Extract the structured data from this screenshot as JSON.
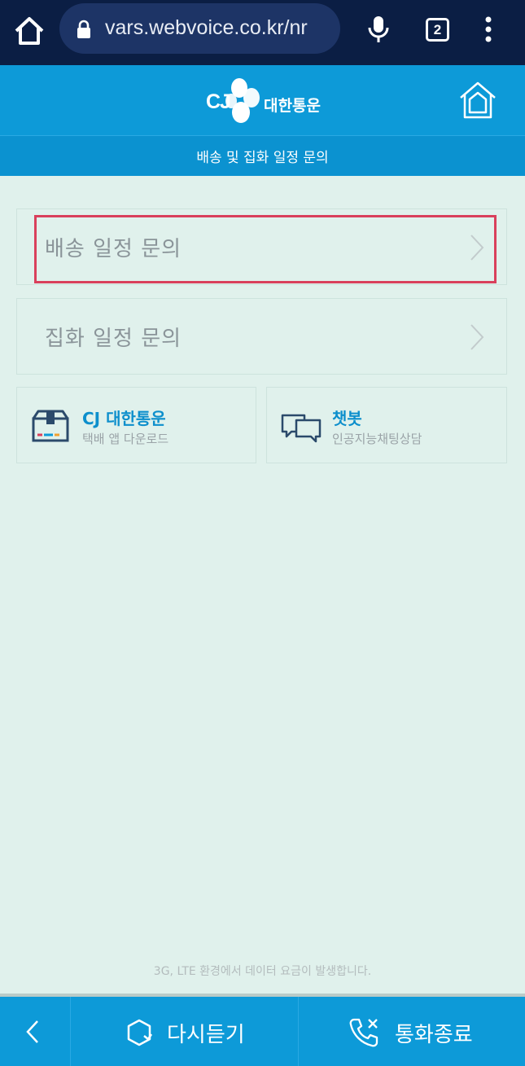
{
  "browser": {
    "url": "vars.webvoice.co.kr/nr",
    "tab_count": "2"
  },
  "header": {
    "logo_cj": "CJ",
    "logo_name": "대한통운",
    "subtitle": "배송 및 집화 일정 문의"
  },
  "menu": {
    "items": [
      {
        "label": "배송 일정 문의"
      },
      {
        "label": "집화 일정 문의"
      }
    ]
  },
  "cards": {
    "app": {
      "title": "CJ 대한통운",
      "subtitle": "택배 앱 다운로드"
    },
    "chatbot": {
      "title": "챗봇",
      "subtitle": "인공지능채팅상담"
    }
  },
  "notice": "3G, LTE 환경에서 데이터 요금이 발생합니다.",
  "bottom": {
    "replay_label": "다시듣기",
    "end_call_label": "통화종료"
  },
  "colors": {
    "brand_blue": "#0d9ad8",
    "highlight": "#d9405c",
    "background": "#e0f1ec"
  }
}
